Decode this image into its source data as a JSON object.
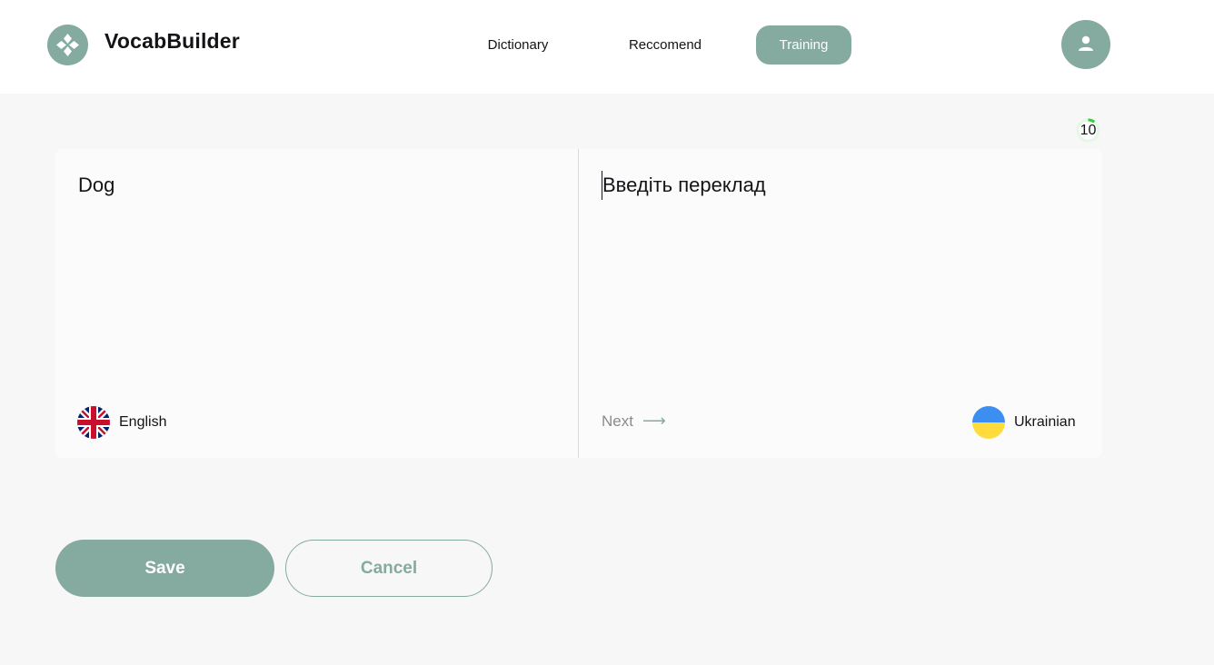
{
  "header": {
    "brand": "VocabBuilder",
    "logo_icon": "clover-icon",
    "nav": [
      {
        "label": "Dictionary",
        "active": false
      },
      {
        "label": "Reccomend",
        "active": false
      },
      {
        "label": "Training",
        "active": true
      }
    ],
    "avatar_icon": "user-icon"
  },
  "training": {
    "progress": {
      "value": "10",
      "fraction": 0.1,
      "color": "#2bd62b"
    },
    "word": "Dog",
    "translation": {
      "placeholder": "Введіть переклад",
      "value": ""
    },
    "source_language": {
      "label": "English",
      "flag_icon": "uk-flag-icon"
    },
    "target_language": {
      "label": "Ukrainian",
      "flag_icon": "ukraine-flag-icon"
    },
    "next_label": "Next",
    "next_icon": "arrow-right-icon"
  },
  "actions": {
    "save_label": "Save",
    "cancel_label": "Cancel"
  },
  "colors": {
    "accent": "#85aa9f",
    "background": "#f7f7f7",
    "text": "#121417"
  }
}
